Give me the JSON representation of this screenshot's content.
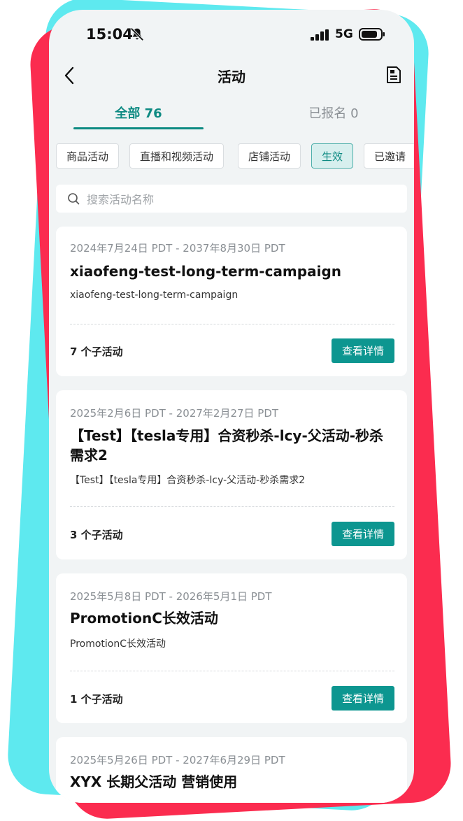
{
  "status": {
    "time": "15:04",
    "network": "5G"
  },
  "nav": {
    "title": "活动"
  },
  "tabs": [
    {
      "label": "全部 76",
      "active": true
    },
    {
      "label": "已报名 0",
      "active": false
    }
  ],
  "filters": [
    "商品活动",
    "直播和视频活动",
    "店铺活动",
    "生效",
    "已邀请"
  ],
  "search": {
    "placeholder": "搜索活动名称"
  },
  "campaigns": [
    {
      "date": "2024年7月24日 PDT - 2037年8月30日 PDT",
      "title": "xiaofeng-test-long-term-campaign",
      "subtitle": "xiaofeng-test-long-term-campaign",
      "count": "7 个子活动",
      "button": "查看详情"
    },
    {
      "date": "2025年2月6日 PDT - 2027年2月27日 PDT",
      "title": "【Test】【tesla专用】合资秒杀-lcy-父活动-秒杀需求2",
      "subtitle": "【Test】【tesla专用】合资秒杀-lcy-父活动-秒杀需求2",
      "count": "3 个子活动",
      "button": "查看详情"
    },
    {
      "date": "2025年5月8日 PDT - 2026年5月1日 PDT",
      "title": "PromotionC长效活动",
      "subtitle": "PromotionC长效活动",
      "count": "1 个子活动",
      "button": "查看详情"
    },
    {
      "date": "2025年5月26日 PDT - 2027年6月29日 PDT",
      "title": "XYX 长期父活动 营销使用"
    }
  ],
  "colors": {
    "accent": "#0d8a82",
    "button": "#0d9690",
    "frame_red": "#fb2c4f",
    "frame_cyan": "#5ee9ef"
  }
}
